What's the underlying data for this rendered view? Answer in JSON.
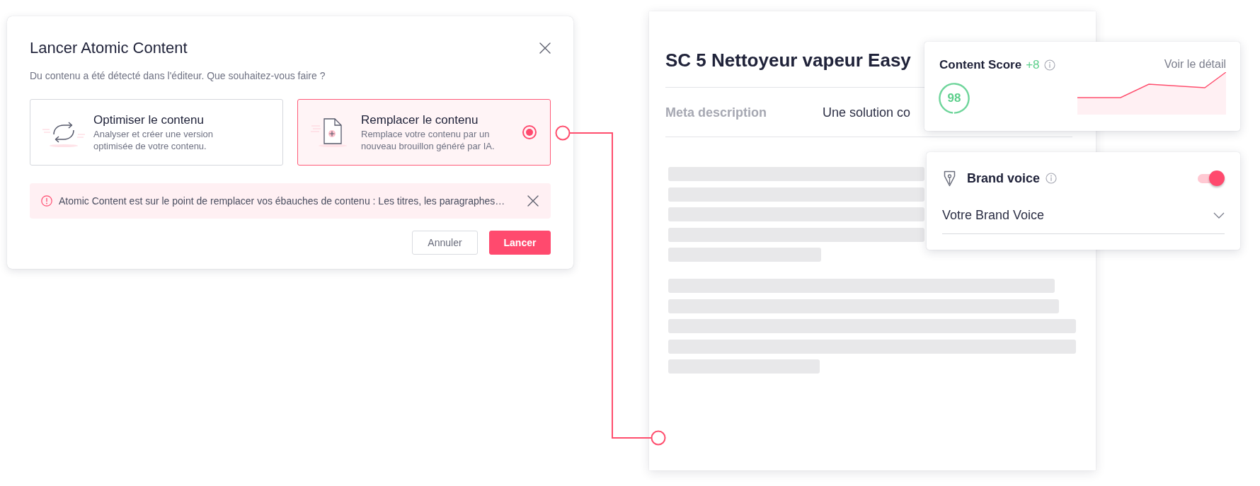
{
  "dialog": {
    "title": "Lancer Atomic Content",
    "subtitle": "Du contenu a été détecté dans l'éditeur. Que souhaitez-vous faire ?",
    "options": [
      {
        "kind": "optimize",
        "title": "Optimiser le contenu",
        "description": "Analyser et créer une version optimisée de votre contenu.",
        "selected": false
      },
      {
        "kind": "replace",
        "title": "Remplacer le contenu",
        "description": "Remplace votre contenu par un nouveau brouillon généré par IA.",
        "selected": true
      }
    ],
    "alert": {
      "text": "Atomic Content est sur le point de remplacer vos ébauches de contenu : Les titres, les paragraphes…"
    },
    "buttons": [
      {
        "kind": "secondary",
        "label": "Annuler"
      },
      {
        "kind": "primary",
        "label": "Lancer"
      }
    ]
  },
  "document": {
    "title": "SC 5 Nettoyeur vapeur Easy",
    "meta_label": "Meta description",
    "meta_value": "Une solution co"
  },
  "content_score": {
    "title": "Content Score",
    "delta": "+8",
    "score": "98",
    "level": 0.98,
    "link": "Voir le détail"
  },
  "brand_voice": {
    "title": "Brand voice",
    "enabled": true,
    "value": "Votre Brand Voice"
  }
}
